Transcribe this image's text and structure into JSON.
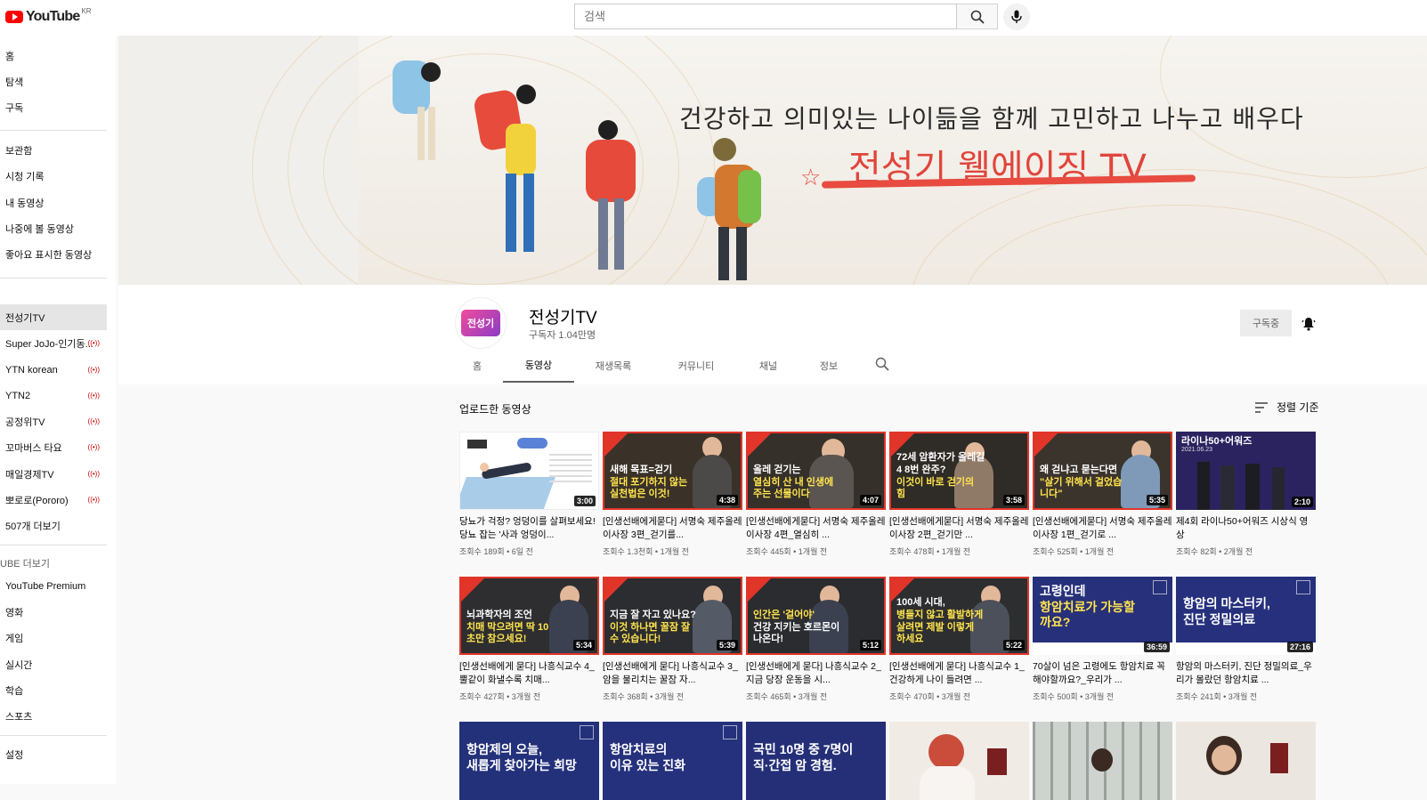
{
  "topbar": {
    "logo_text": "YouTube",
    "logo_region": "KR",
    "search_placeholder": "검색"
  },
  "sidebar": {
    "main": [
      "홈",
      "탐색",
      "구독"
    ],
    "library": [
      "보관함",
      "시청 기록",
      "내 동영상",
      "나중에 볼 동영상",
      "좋아요 표시한 동영상"
    ],
    "subscriptions": [
      {
        "label": "전성기TV",
        "live": false,
        "active": true
      },
      {
        "label": "Super JoJo-인기동...",
        "live": true
      },
      {
        "label": "YTN korean",
        "live": true
      },
      {
        "label": "YTN2",
        "live": true
      },
      {
        "label": "공정위TV",
        "live": true
      },
      {
        "label": "꼬마버스 타요",
        "live": true
      },
      {
        "label": "매일경제TV",
        "live": true
      },
      {
        "label": "뽀로로(Pororo)",
        "live": true
      }
    ],
    "more_subs": "507개 더보기",
    "more_heading": "UBE 더보기",
    "more_items": [
      "YouTube Premium",
      "영화",
      "게임",
      "실시간",
      "학습",
      "스포츠"
    ],
    "settings": "설정"
  },
  "banner": {
    "title": "건강하고 의미있는 나이듦을 함께 고민하고 나누고 배우다",
    "subtitle": "전성기 웰에이징 TV"
  },
  "channel": {
    "avatar_text": "전성기",
    "name": "전성기TV",
    "subscribers": "구독자 1.04만명",
    "subscribe_label": "구독중",
    "tabs": [
      "홈",
      "동영상",
      "재생목록",
      "커뮤니티",
      "채널",
      "정보"
    ],
    "active_tab": "동영상"
  },
  "content": {
    "section_title": "업로드한 동영상",
    "sort_label": "정렬 기준",
    "videos": [
      {
        "thumb_line1": "",
        "thumb_line2": "",
        "duration": "3:00",
        "title": "당뇨가 걱정? 엉덩이를 살펴보세요! 당뇨 잡는 '사과 엉덩이...",
        "meta": "조회수 189회 • 6일 전",
        "bg": "#ffffff"
      },
      {
        "thumb_line1": "새해 목표=걷기",
        "thumb_line2": "절대 포기하지 않는 실천법은 이것!",
        "duration": "4:38",
        "title": "[인생선배에게묻다] 서명숙 제주올레 이사장 3편_걷기를...",
        "meta": "조회수 1.3천회 • 1개월 전",
        "bg": "#3a3228"
      },
      {
        "thumb_line1": "올레 걷기는",
        "thumb_line2": "열심히 산 내 인생에 주는 선물이다",
        "duration": "4:07",
        "title": "[인생선배에게묻다] 서명숙 제주올레 이사장 4편_열심히 ...",
        "meta": "조회수 445회 • 1개월 전",
        "bg": "#35302a"
      },
      {
        "thumb_line1": "72세 암환자가 올레길 4 8번 완주?",
        "thumb_line2": "이것이 바로 걷기의 힘",
        "duration": "3:58",
        "title": "[인생선배에게묻다] 서명숙 제주올레 이사장 2편_걷기만 ...",
        "meta": "조회수 478회 • 1개월 전",
        "bg": "#2f2b26"
      },
      {
        "thumb_line1": "왜 걷냐고 묻는다면",
        "thumb_line2": "\"살기 위해서 걸었습니다\"",
        "duration": "5:35",
        "title": "[인생선배에게묻다] 서명숙 제주올레 이사장 1편_걷기로 ...",
        "meta": "조회수 525회 • 1개월 전",
        "bg": "#3b342c"
      },
      {
        "thumb_line1": "라이나50+어워즈",
        "thumb_line2": "2021.06.23",
        "duration": "2:10",
        "title": "제4회 라이나50+어워즈 시상식 영상",
        "meta": "조회수 82회 • 2개월 전",
        "bg": "#2b2360"
      },
      {
        "thumb_line1": "뇌과학자의 조언",
        "thumb_line2": "치매 막으려면 딱 10초만 참으세요!",
        "duration": "5:34",
        "title": "[인생선배에게 묻다] 나흥식교수 4_ 뿔같이 화낼수록 치매...",
        "meta": "조회수 427회 • 3개월 전",
        "bg": "#2e2e30"
      },
      {
        "thumb_line1": "지금 잘 자고 있나요?",
        "thumb_line2": "이것 하나면 꿀잠 잘 수 있습니다!",
        "duration": "5:39",
        "title": "[인생선배에게 묻다] 나흥식교수 3_ 암을 물리치는 꿀잠 자...",
        "meta": "조회수 368회 • 3개월 전",
        "bg": "#2c2d30"
      },
      {
        "thumb_line1": "인간은 '걸어야'",
        "thumb_line2": "건강 지키는 호르몬이 나온다!",
        "duration": "5:12",
        "title": "[인생선배에게 묻다] 나흥식교수 2_지금 당장 운동을 시...",
        "meta": "조회수 465회 • 3개월 전",
        "bg": "#2b2c2f"
      },
      {
        "thumb_line1": "100세 시대,",
        "thumb_line2": "병들지 않고 활발하게 살려면 제발 이렇게 하세요",
        "duration": "5:22",
        "title": "[인생선배에게 묻다] 나흥식교수 1_ 건강하게 나이 들려면 ...",
        "meta": "조회수 470회 • 3개월 전",
        "bg": "#2d2e30"
      },
      {
        "thumb_line1": "고령인데",
        "thumb_line2": "항암치료가 가능할까요?",
        "duration": "36:59",
        "title": "70살이 넘은 고령에도 항암치료 꼭 해야할까요?_우리가 ...",
        "meta": "조회수 500회 • 3개월 전",
        "bg": "#27307a"
      },
      {
        "thumb_line1": "항암의 마스터키,",
        "thumb_line2": "진단 정밀의료",
        "duration": "27:16",
        "title": "항암의 마스터키, 진단 정밀의료_우리가 몰랐던 항암치료 ...",
        "meta": "조회수 241회 • 3개월 전",
        "bg": "#26307d"
      },
      {
        "thumb_line1": "항암제의 오늘,",
        "thumb_line2": "새롭게 찾아가는 희망",
        "duration": "",
        "title": "",
        "meta": "",
        "bg": "#23307a"
      },
      {
        "thumb_line1": "항암치료의",
        "thumb_line2": "이유 있는 진화",
        "duration": "",
        "title": "",
        "meta": "",
        "bg": "#25317c"
      },
      {
        "thumb_line1": "국민 10명 중 7명이",
        "thumb_line2": "직·간접 암 경험.",
        "duration": "",
        "title": "",
        "meta": "",
        "bg": "#242f78"
      },
      {
        "thumb_line1": "",
        "thumb_line2": "",
        "duration": "",
        "title": "",
        "meta": "",
        "bg": "#f1ebe6"
      },
      {
        "thumb_line1": "",
        "thumb_line2": "",
        "duration": "",
        "title": "",
        "meta": "",
        "bg": "#cfd3cf"
      },
      {
        "thumb_line1": "",
        "thumb_line2": "",
        "duration": "",
        "title": "",
        "meta": "",
        "bg": "#ece6e0"
      }
    ]
  },
  "colors": {
    "accent_red": "#ff0000",
    "banner_red": "#e0453c",
    "live_red": "#cc0000",
    "text_secondary": "#606060"
  }
}
